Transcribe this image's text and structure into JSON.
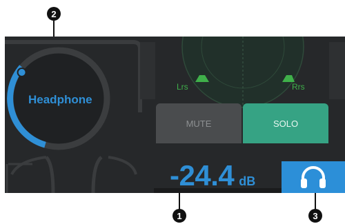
{
  "knob": {
    "label": "Headphone",
    "level_fraction": 0.22
  },
  "speakers": {
    "left_label": "Lrs",
    "right_label": "Rrs"
  },
  "buttons": {
    "mute_label": "MUTE",
    "solo_label": "SOLO"
  },
  "level_display": {
    "value": "-24.4",
    "unit": "dB"
  },
  "callouts": {
    "one": "1",
    "two": "2",
    "three": "3"
  },
  "colors": {
    "accent_blue": "#2f8fd6",
    "solo_green": "#36a384",
    "panel_bg": "#26282a",
    "mute_gray": "#4a4c4e"
  },
  "icons": {
    "headphones": "headphones-icon"
  }
}
